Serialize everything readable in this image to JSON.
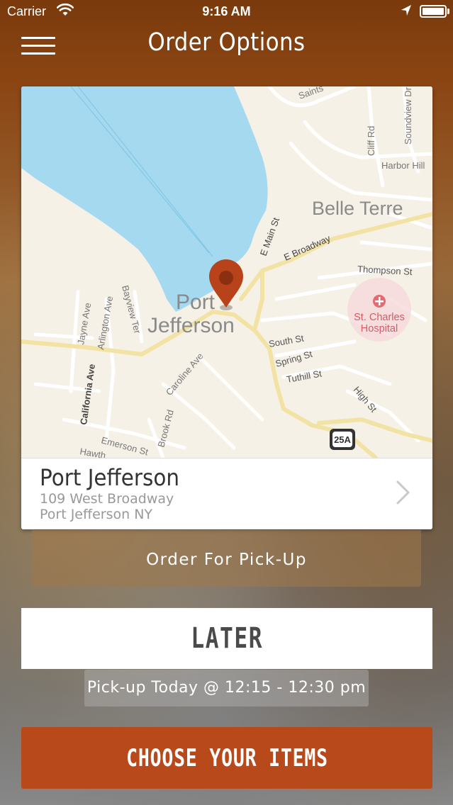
{
  "status_bar": {
    "carrier": "Carrier",
    "time": "9:16 AM",
    "wifi_icon": "wifi-icon",
    "location_icon": "location-arrow-icon",
    "battery_icon": "battery-icon"
  },
  "header": {
    "title": "Order Options",
    "menu_icon": "hamburger-menu-icon"
  },
  "store": {
    "name": "Port Jefferson",
    "address_line1": "109 West Broadway",
    "address_line2": "Port Jefferson NY",
    "chevron_icon": "chevron-right-icon"
  },
  "map": {
    "place_main_1": "Port",
    "place_main_2": "Jefferson",
    "place_belle": "Belle Terre",
    "hospital_1": "St. Charles",
    "hospital_2": "Hospital",
    "streets": {
      "saints": "Saints",
      "cliff": "Cliff Rd",
      "soundview": "Soundview Dr",
      "harbor": "Harbor Hill",
      "emain": "E Main St",
      "ebroadway": "E Broadway",
      "thompson": "Thompson St",
      "jayne": "Jayne Ave",
      "arlington": "Arlington Ave",
      "bayview": "Bayview Ter",
      "south": "South St",
      "spring": "Spring St",
      "tuthill": "Tuthill St",
      "high": "High St",
      "california": "California Ave",
      "caroline": "Caroline Ave",
      "brook": "Brook Rd",
      "emerson": "Emerson St",
      "hawth": "Hawth"
    },
    "route_shield": "25A",
    "pin_icon": "map-pin-icon",
    "hospital_icon": "hospital-cross-icon",
    "water_color": "#a5d9f0",
    "land_color": "#f6f1e6",
    "pin_color": "#b8421a"
  },
  "order_type": {
    "label": "Order For Pick-Up"
  },
  "timing": {
    "label": "LATER",
    "pickup_time": "Pick-up Today @ 12:15 - 12:30 pm"
  },
  "cta": {
    "label": "CHOOSE YOUR ITEMS",
    "color": "#b8491a"
  }
}
